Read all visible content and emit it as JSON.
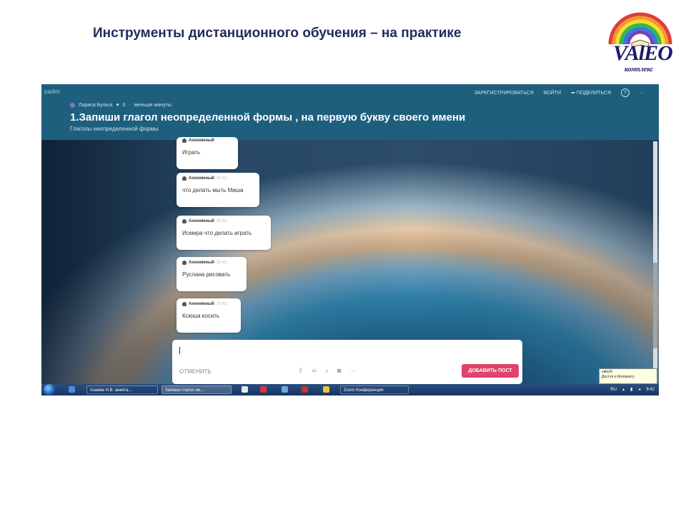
{
  "slide": {
    "title": "Инструменты дистанционного обучения – на практике",
    "logo": {
      "big": "VAlEO",
      "small": "комплекс"
    }
  },
  "padlet": {
    "brand": "padlet",
    "nav": {
      "register": "зарегистрироваться",
      "login": "войти",
      "share": "поделиться",
      "help": "?",
      "more": "···"
    },
    "meta": {
      "author": "Лариса Бульга",
      "likes": "0",
      "time": "меньше минуты"
    },
    "board_title": "1.Запиши глагол неопределенной формы , на первую букву своего имени",
    "board_subtitle": "Глаголы неопределенной формы",
    "posts": [
      {
        "author": "Анонимный",
        "time": "",
        "text": "Играть"
      },
      {
        "author": "Анонимный",
        "time": "20:41",
        "text": "что делать мыть Миша"
      },
      {
        "author": "Анонимный",
        "time": "20:41",
        "text": "Исмира что делать играть"
      },
      {
        "author": "Анонимный",
        "time": "20:41",
        "text": "Руслана рисовать"
      },
      {
        "author": "Анонимный",
        "time": "20:41",
        "text": "Ксюша косить"
      }
    ],
    "composer": {
      "cancel_label": "отменить",
      "submit_label": "ДОБАВИТЬ ПОСТ"
    }
  },
  "tooltip": {
    "line1": "valeo5",
    "line2": "Доступ к Интернету"
  },
  "taskbar": {
    "items": [
      {
        "label": "Азаева Н.В. анкета..."
      },
      {
        "label": "Запиши глагол не..."
      },
      {
        "label": "Zoom Конференция"
      }
    ],
    "lang": "RU",
    "clock": "9:42"
  },
  "colors": {
    "accent": "#e0436b",
    "topbar": "#1e5f7e",
    "title": "#1f2a5a"
  }
}
